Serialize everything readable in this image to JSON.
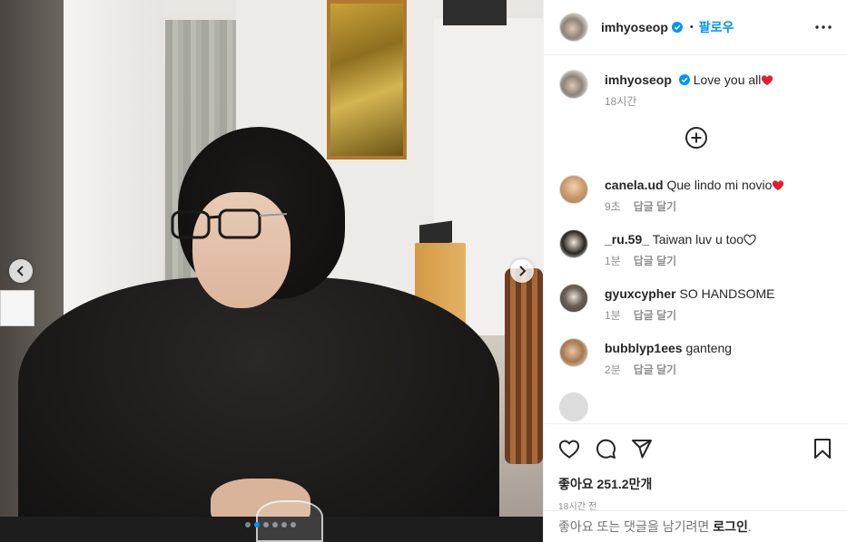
{
  "post": {
    "username": "imhyoseop",
    "separator": "•",
    "follow_label": "팔로우",
    "caption_text": "Love you all",
    "caption_time": "18시간",
    "likes_text": "좋아요 251.2만개",
    "time_text": "18시간 전"
  },
  "carousel": {
    "dots": 6,
    "active_index": 1
  },
  "comments": [
    {
      "username": "canela.ud",
      "text": "Que lindo mi novio",
      "emoji": "red-heart",
      "time": "9초",
      "reply": "답글 달기",
      "avatar": "av-canela"
    },
    {
      "username": "_ru.59_",
      "text": "Taiwan luv u too",
      "emoji": "white-heart",
      "time": "1분",
      "reply": "답글 달기",
      "avatar": "av-ru"
    },
    {
      "username": "gyuxcypher",
      "text": "SO HANDSOME",
      "emoji": "",
      "time": "1분",
      "reply": "답글 달기",
      "avatar": "av-gyu"
    },
    {
      "username": "bubblyp1ees",
      "text": "ganteng",
      "emoji": "",
      "time": "2분",
      "reply": "답글 달기",
      "avatar": "av-bub"
    }
  ],
  "login_prompt": {
    "text": "좋아요 또는 댓글을 남기려면",
    "link": "로그인",
    "end": "."
  },
  "colors": {
    "accent": "#0095f6",
    "heart": "#ed4956",
    "muted": "#8e8e8e",
    "text": "#262626"
  }
}
